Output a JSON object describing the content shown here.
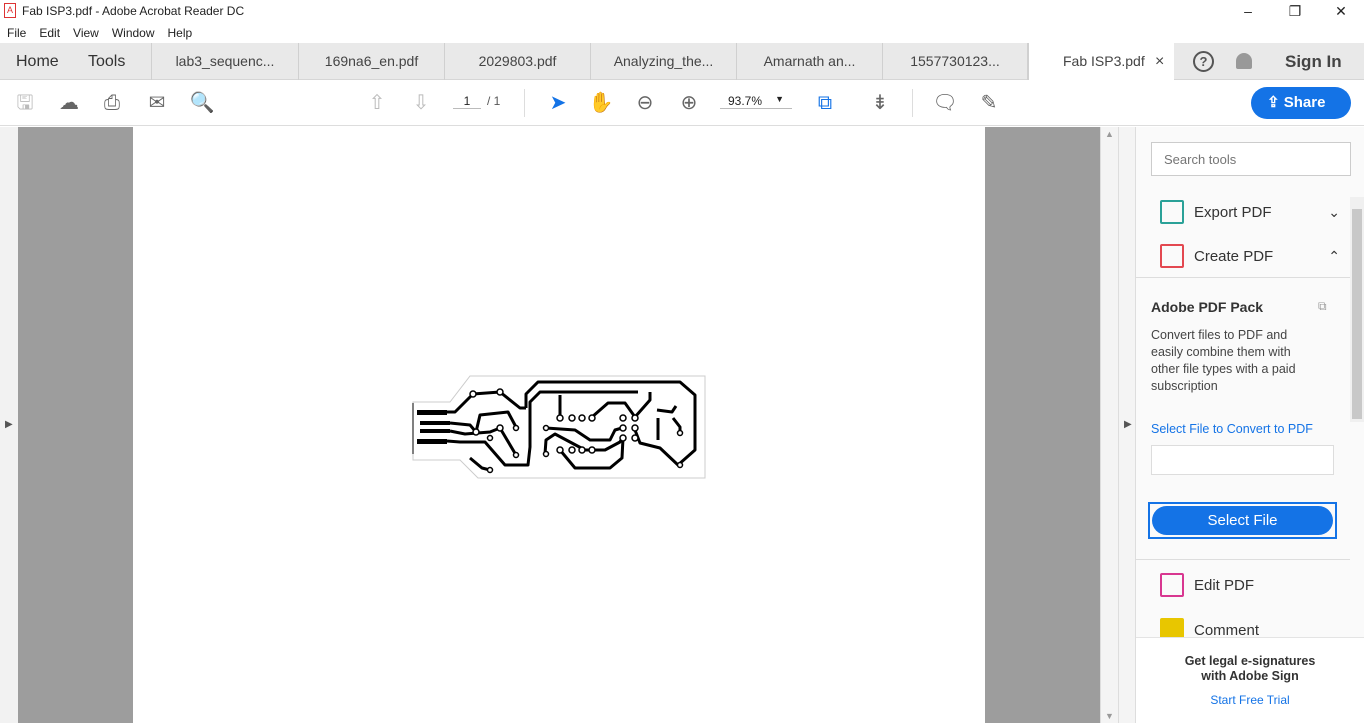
{
  "window": {
    "title": "Fab ISP3.pdf - Adobe Acrobat Reader DC",
    "minimize": "–",
    "maximize": "❐",
    "close": "✕"
  },
  "menu": [
    "File",
    "Edit",
    "View",
    "Window",
    "Help"
  ],
  "tabs": {
    "home": "Home",
    "tools": "Tools",
    "documents": [
      "lab3_sequenc...",
      "169na6_en.pdf",
      "2029803.pdf",
      "Analyzing_the...",
      "Amarnath an...",
      "1557730123...",
      "Fab ISP3.pdf"
    ],
    "close": "×",
    "help": "?",
    "sign_in": "Sign In"
  },
  "toolbar": {
    "page_current": "1",
    "page_total": "/ 1",
    "zoom": "93.7%",
    "share": "Share"
  },
  "panel": {
    "search_placeholder": "Search tools",
    "export_pdf": "Export PDF",
    "create_pdf": "Create PDF",
    "pack_title": "Adobe PDF Pack",
    "pack_desc": "Convert files to PDF and easily combine them with other file types with a paid subscription",
    "select_link": "Select File to Convert to PDF",
    "select_button": "Select File",
    "edit_pdf": "Edit PDF",
    "comment": "Comment",
    "promo_line1": "Get legal e-signatures",
    "promo_line2": "with Adobe Sign",
    "trial": "Start Free Trial"
  },
  "colors": {
    "accent": "#1473e6",
    "export": "#2aa198",
    "create": "#e34850",
    "edit": "#d83790",
    "comment": "#e8c600"
  }
}
